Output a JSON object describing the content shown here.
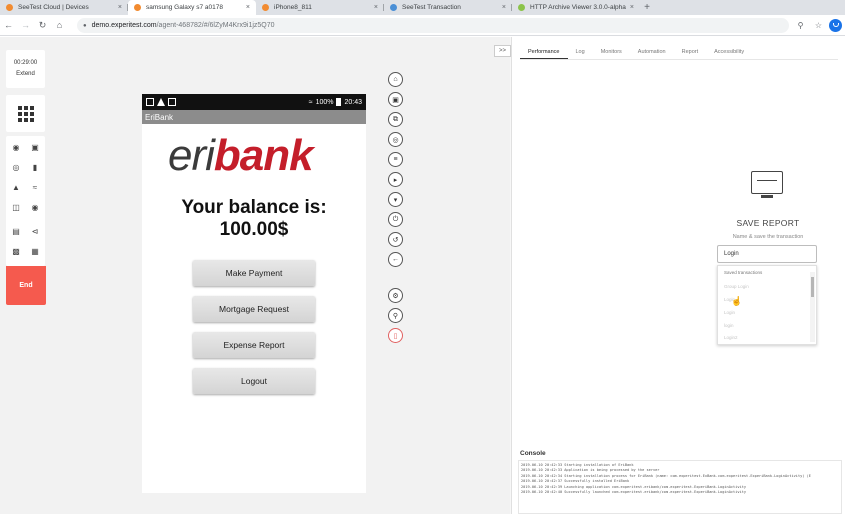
{
  "browser": {
    "tabs": [
      {
        "title": "SeeTest Cloud | Devices",
        "favicon_color": "#f28b30",
        "active": false
      },
      {
        "title": "samsung Galaxy s7 a0178",
        "favicon_color": "#f28b30",
        "active": true
      },
      {
        "title": "iPhone8_811",
        "favicon_color": "#f28b30",
        "active": false
      },
      {
        "title": "SeeTest Transaction",
        "favicon_color": "#4a8fd6",
        "active": false
      },
      {
        "title": "HTTP Archive Viewer 3.0.0-alpha",
        "favicon_color": "#8bc34a",
        "active": false
      }
    ],
    "close_glyph": "×",
    "new_tab_glyph": "+",
    "url_domain": "demo.experitest.com",
    "url_path": "/agent-468782/#/6lZyM4Krx9i1jz5Q70"
  },
  "left_controls": {
    "timer": "00:29:00",
    "extend_label": "Extend",
    "end_label": "End",
    "tool_icons": [
      "location-icon",
      "camera-icon",
      "fingerprint-icon",
      "battery-icon",
      "warning-icon",
      "wifi-icon",
      "rotate-icon",
      "globe-icon",
      "clipboard-icon",
      "share-icon",
      "install-icon",
      "image-icon"
    ]
  },
  "phone": {
    "clock": "20:43",
    "battery": "100%",
    "app_title": "EriBank",
    "logo_eri": "eri",
    "logo_bank": "bank",
    "balance_line1": "Your balance is:",
    "balance_line2": "100.00$",
    "buttons": [
      "Make Payment",
      "Mortgage Request",
      "Expense Report",
      "Logout"
    ]
  },
  "device_controls": [
    "home-icon",
    "lock-icon",
    "copy-icon",
    "settings-wheel-icon",
    "menu-icon",
    "volume-up-icon",
    "volume-down-icon",
    "power-icon",
    "recent-apps-icon",
    "back-icon",
    "gear-icon",
    "zoom-icon",
    "phone-icon"
  ],
  "right_panel": {
    "collapse_label": ">>",
    "tabs": [
      "Performance",
      "Log",
      "Monitors",
      "Automation",
      "Report",
      "Accessibility"
    ],
    "active_tab": "Performance",
    "save_title": "SAVE REPORT",
    "save_subtitle": "Name & save the transaction",
    "name_value": "Login",
    "dropdown_header": "Saved transactions",
    "dropdown_items": [
      "Group Login",
      "Login",
      "Login",
      "login",
      "Login2"
    ],
    "console_title": "Console",
    "console_lines": [
      "2019-06-10 20:42:33 Starting installation of EriBank",
      "2019-06-10 20:42:33 Application is being processed by the server",
      "2019-06-10 20:42:34 Starting installation process for EriBank (name: com.experitest.ExBank.com.experitest.ExperiBank.LoginActivity) (E",
      "2019-06-10 20:42:37 Successfully installed EriBank",
      "2019-06-10 20:42:39 Launching application com.experitest.eribank/com.experitest.ExperiBank.LoginActivity",
      "2019-06-10 20:42:40 Successfully launched com.experitest.eribank/com.experitest.ExperiBank.LoginActivity"
    ]
  }
}
